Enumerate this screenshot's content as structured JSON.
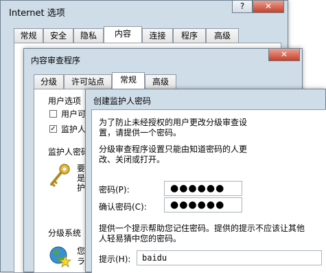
{
  "internet_options": {
    "title": "Internet 选项",
    "help_glyph": "?",
    "close_glyph": "✕",
    "tabs": [
      "常规",
      "安全",
      "隐私",
      "内容",
      "连接",
      "程序",
      "高级"
    ]
  },
  "content_advisor": {
    "title": "内容审查程序",
    "close_glyph": "✕",
    "tabs": [
      "分级",
      "许可站点",
      "常规",
      "高级"
    ],
    "user_options": {
      "title": "用户选项",
      "option1": "用户可",
      "option2": "监护人"
    },
    "supervisor": {
      "title": "监护人密码",
      "text_line1": "要",
      "text_line2": "是",
      "text_line3": "护"
    },
    "rating_system": {
      "title": "分级系统",
      "text_line1": "您",
      "text_line2": "ラ"
    }
  },
  "create_password": {
    "title": "创建监护人密码",
    "intro_line1": "为了防止未经授权的用户更改分级审查设",
    "intro_line2": "置，请提供一个密码。",
    "info_line1": "分级审查程序设置只能由知道密码的人更",
    "info_line2": "改、关闭或打开。",
    "password_label": "密码(P):",
    "password_value": "●●●●●●",
    "confirm_label": "确认密码(C):",
    "confirm_value": "●●●●●●",
    "hint_info_line1": "提供一个提示帮助您记住密码。提供的提示不应该让其他",
    "hint_info_line2": "人轻易猜中您的密码。",
    "hint_label": "提示(H):",
    "hint_value": "baidu"
  }
}
